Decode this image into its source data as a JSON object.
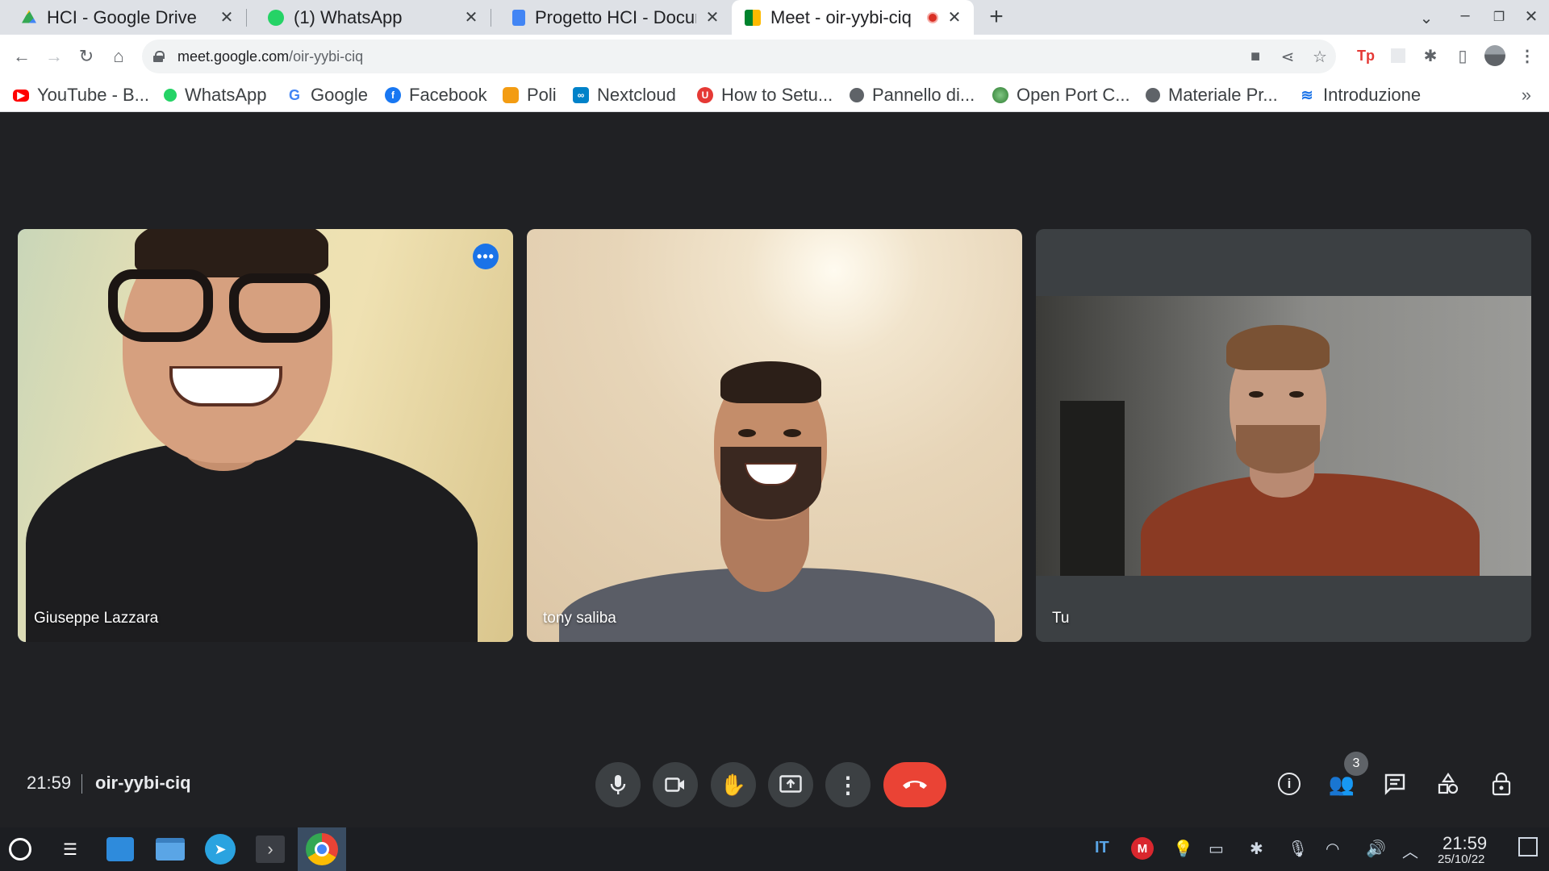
{
  "browser": {
    "tabs": [
      {
        "title": "HCI - Google Drive",
        "favicon": "google-drive-icon",
        "color": "#fbbc04"
      },
      {
        "title": "(1) WhatsApp",
        "favicon": "whatsapp-icon",
        "color": "#25d366"
      },
      {
        "title": "Progetto HCI - Docum",
        "favicon": "google-docs-icon",
        "color": "#4285f4"
      },
      {
        "title": "Meet - oir-yybi-ciq",
        "favicon": "google-meet-icon",
        "color": "#00897b",
        "active": true,
        "recording": true
      }
    ],
    "url_host": "meet.google.com",
    "url_path": "/oir-yybi-ciq",
    "bookmarks": [
      {
        "label": "YouTube - B...",
        "icon": "youtube-icon",
        "color": "#ff0000"
      },
      {
        "label": "WhatsApp",
        "icon": "whatsapp-icon",
        "color": "#25d366"
      },
      {
        "label": "Google",
        "icon": "google-icon",
        "color": "#4285f4"
      },
      {
        "label": "Facebook",
        "icon": "facebook-icon",
        "color": "#1877f2"
      },
      {
        "label": "Poli",
        "icon": "poli-icon",
        "color": "#f39c12"
      },
      {
        "label": "Nextcloud",
        "icon": "nextcloud-icon",
        "color": "#0082c9"
      },
      {
        "label": "How to Setu...",
        "icon": "site-icon",
        "color": "#e53935"
      },
      {
        "label": "Pannello di...",
        "icon": "globe-icon",
        "color": "#5f6368"
      },
      {
        "label": "Open Port C...",
        "icon": "globe-icon",
        "color": "#43a047"
      },
      {
        "label": "Materiale Pr...",
        "icon": "globe-icon",
        "color": "#5f6368"
      },
      {
        "label": "Introduzione",
        "icon": "doc-icon",
        "color": "#1a73e8"
      }
    ]
  },
  "meet": {
    "participants": [
      {
        "name": "Giuseppe Lazzara",
        "speaking": true
      },
      {
        "name": "tony saliba",
        "speaking": false
      },
      {
        "name": "Tu",
        "speaking": false
      }
    ],
    "time": "21:59",
    "meeting_code": "oir-yybi-ciq",
    "people_count": "3",
    "controls": [
      "microphone-icon",
      "camera-icon",
      "raise-hand-icon",
      "present-screen-icon",
      "more-options-icon",
      "end-call-icon"
    ],
    "side_controls": [
      "info-icon",
      "people-icon",
      "chat-icon",
      "activities-icon",
      "host-controls-icon"
    ]
  },
  "taskbar": {
    "language": "IT",
    "clock_time": "21:59",
    "clock_date": "25/10/22"
  }
}
